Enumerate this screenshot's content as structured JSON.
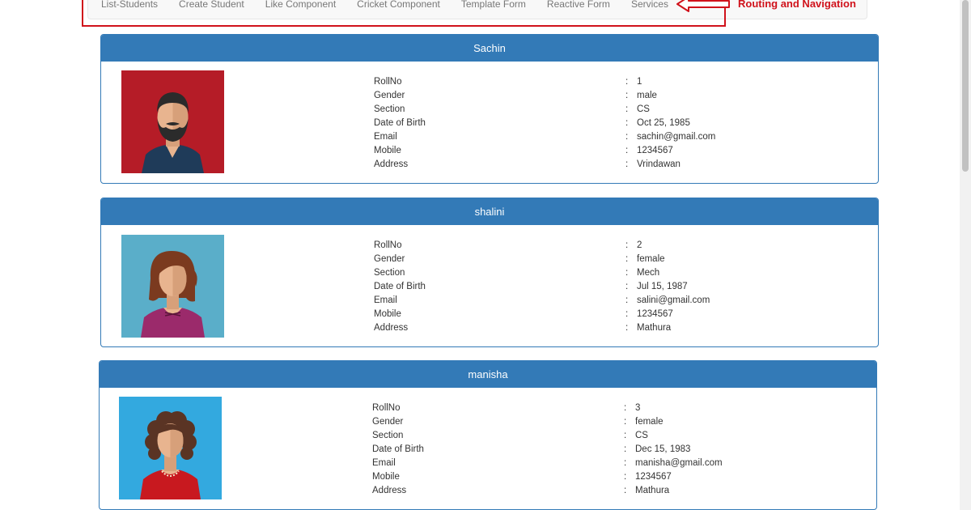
{
  "nav": {
    "items": [
      {
        "label": "List-Students"
      },
      {
        "label": "Create Student"
      },
      {
        "label": "Like Component"
      },
      {
        "label": "Cricket Component"
      },
      {
        "label": "Template Form"
      },
      {
        "label": "Reactive Form"
      },
      {
        "label": "Services"
      }
    ]
  },
  "annotation": {
    "text": "Routing and Navigation",
    "color": "#d0121b"
  },
  "labels": {
    "rollno": "RollNo",
    "gender": "Gender",
    "section": "Section",
    "dob": "Date of Birth",
    "email": "Email",
    "mobile": "Mobile",
    "address": "Address",
    "separator": ":"
  },
  "students": [
    {
      "name": "Sachin",
      "rollno": "1",
      "gender": "male",
      "section": "CS",
      "dob": "Oct 25, 1985",
      "email": "sachin@gmail.com",
      "mobile": "1234567",
      "address": "Vrindawan",
      "avatar_icon": "male-bearded-avatar-icon",
      "avatar_bg": "#b51c27"
    },
    {
      "name": "shalini",
      "rollno": "2",
      "gender": "female",
      "section": "Mech",
      "dob": "Jul 15, 1987",
      "email": "salini@gmail.com",
      "mobile": "1234567",
      "address": "Mathura",
      "avatar_icon": "female-avatar-icon",
      "avatar_bg": "#5aaec9"
    },
    {
      "name": "manisha",
      "rollno": "3",
      "gender": "female",
      "section": "CS",
      "dob": "Dec 15, 1983",
      "email": "manisha@gmail.com",
      "mobile": "1234567",
      "address": "Mathura",
      "avatar_icon": "female-curly-avatar-icon",
      "avatar_bg": "#33a9df"
    }
  ],
  "colors": {
    "panel_header": "#337ab7",
    "navbar_bg": "#f8f8f8"
  }
}
